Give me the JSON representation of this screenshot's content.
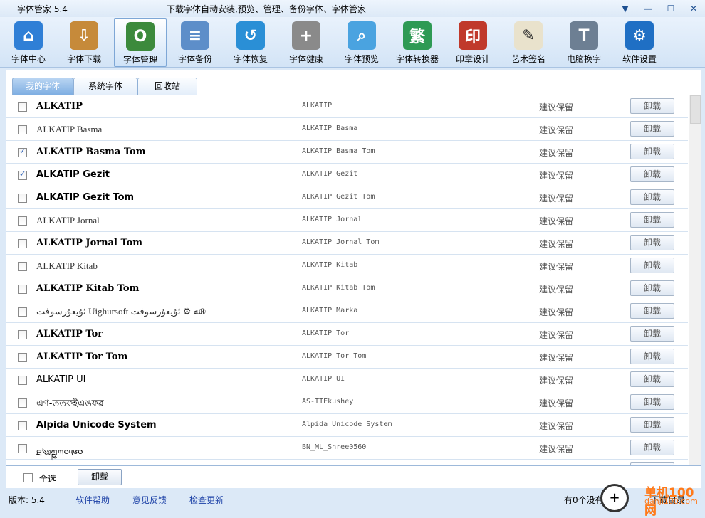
{
  "window": {
    "title": "字体管家 5.4",
    "subtitle": "下载字体自动安装,预览、管理、备份字体、字体管家"
  },
  "toolbar": [
    {
      "label": "字体中心",
      "icon": "house-icon",
      "color": "#2f7fd6",
      "glyph": "⌂"
    },
    {
      "label": "字体下载",
      "icon": "download-box-icon",
      "color": "#c68a3a",
      "glyph": "⇩"
    },
    {
      "label": "字体管理",
      "icon": "font-o-icon",
      "color": "#3c8a3c",
      "glyph": "O",
      "active": true
    },
    {
      "label": "字体备份",
      "icon": "document-icon",
      "color": "#5d8ec9",
      "glyph": "≡"
    },
    {
      "label": "字体恢复",
      "icon": "restore-icon",
      "color": "#2a8fd6",
      "glyph": "↺"
    },
    {
      "label": "字体健康",
      "icon": "medkit-icon",
      "color": "#8a8a8a",
      "glyph": "+"
    },
    {
      "label": "字体预览",
      "icon": "magnifier-icon",
      "color": "#4aa3e0",
      "glyph": "⌕"
    },
    {
      "label": "字体转换器",
      "icon": "convert-icon",
      "color": "#2e9a54",
      "glyph": "繁"
    },
    {
      "label": "印章设计",
      "icon": "seal-icon",
      "color": "#c0392b",
      "glyph": "印"
    },
    {
      "label": "艺术签名",
      "icon": "signature-icon",
      "color": "#e9e2cc",
      "glyph": "✎"
    },
    {
      "label": "电脑换字",
      "icon": "monitor-t-icon",
      "color": "#6d7f93",
      "glyph": "T"
    },
    {
      "label": "软件设置",
      "icon": "gear-icon",
      "color": "#1f6fc4",
      "glyph": "⚙"
    }
  ],
  "tabs": [
    "我的字体",
    "系统字体",
    "回收站"
  ],
  "fonts": [
    {
      "display": "ALKATIP",
      "system": "ALKATIP",
      "status": "建议保留",
      "action": "卸载",
      "checked": false,
      "style": "bold serif"
    },
    {
      "display": "ALKATIP Basma",
      "system": "ALKATIP Basma",
      "status": "建议保留",
      "action": "卸载",
      "checked": false,
      "style": "light"
    },
    {
      "display": "ALKATIP Basma Tom",
      "system": "ALKATIP Basma Tom",
      "status": "建议保留",
      "action": "卸载",
      "checked": true,
      "style": "bold serif"
    },
    {
      "display": "ALKATIP Gezit",
      "system": "ALKATIP Gezit",
      "status": "建议保留",
      "action": "卸载",
      "checked": true,
      "style": "bold"
    },
    {
      "display": "ALKATIP Gezit Tom",
      "system": "ALKATIP Gezit Tom",
      "status": "建议保留",
      "action": "卸载",
      "checked": false,
      "style": "bold"
    },
    {
      "display": "ALKATIP Jornal",
      "system": "ALKATIP Jornal",
      "status": "建议保留",
      "action": "卸载",
      "checked": false,
      "style": "light"
    },
    {
      "display": "ALKATIP Jornal Tom",
      "system": "ALKATIP Jornal Tom",
      "status": "建议保留",
      "action": "卸载",
      "checked": false,
      "style": "bold serif"
    },
    {
      "display": "ALKATIP Kitab",
      "system": "ALKATIP Kitab",
      "status": "建议保留",
      "action": "卸载",
      "checked": false,
      "style": "light"
    },
    {
      "display": "ALKATIP Kitab Tom",
      "system": "ALKATIP Kitab Tom",
      "status": "建议保留",
      "action": "卸载",
      "checked": false,
      "style": "bold serif"
    },
    {
      "display": "ئۇيغۇرسوفت Uighursoft ﷲ ⚙ ئۇيغۇرسوفت®",
      "system": "ALKATIP Marka",
      "status": "建议保留",
      "action": "卸载",
      "checked": false,
      "style": "light"
    },
    {
      "display": "ALKATIP Tor",
      "system": "ALKATIP Tor",
      "status": "建议保留",
      "action": "卸载",
      "checked": false,
      "style": "bold serif"
    },
    {
      "display": "ALKATIP Tor Tom",
      "system": "ALKATIP Tor Tom",
      "status": "建议保留",
      "action": "卸载",
      "checked": false,
      "style": "bold serif"
    },
    {
      "display": "ALKATIP UI",
      "system": "ALKATIP UI",
      "status": "建议保留",
      "action": "卸载",
      "checked": false,
      "style": "plain"
    },
    {
      "display": "এণ-ততফইএঙফৱ",
      "system": "AS-TTEkushey",
      "status": "建议保留",
      "action": "卸载",
      "checked": false,
      "style": "plain"
    },
    {
      "display": "Alpida Unicode System",
      "system": "Alpida Unicode System",
      "status": "建议保留",
      "action": "卸载",
      "checked": false,
      "style": "bold"
    },
    {
      "display": "ཐ༄ཀྵཀ༠༥༦༠",
      "system": "BN_ML_Shree0560",
      "status": "建议保留",
      "action": "卸载",
      "checked": false,
      "style": "plain"
    },
    {
      "display": "",
      "system": "",
      "status": "建议保留",
      "action": "卸载",
      "checked": false,
      "style": "plain"
    }
  ],
  "bottom": {
    "select_all": "全选",
    "bulk_uninstall": "卸载"
  },
  "status": {
    "version": "版本: 5.4",
    "links": [
      "软件帮助",
      "意见反馈",
      "检查更新"
    ],
    "message": "有0个没有完成",
    "download_dir": "下载目录"
  },
  "watermark": {
    "line1": "单机100网",
    "line2": "danji100.com"
  }
}
